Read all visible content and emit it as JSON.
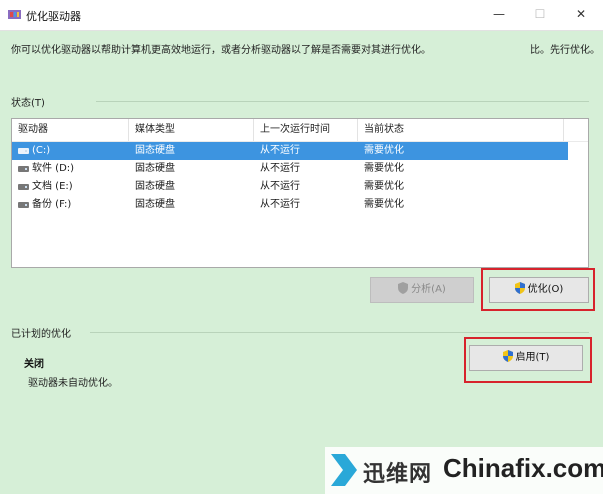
{
  "window": {
    "title": "优化驱动器",
    "controls": {
      "minimize": "—",
      "maximize": "☐",
      "close": "✕"
    }
  },
  "description": "你可以优化驱动器以帮助计算机更高效地运行，或者分析驱动器以了解是否需要对其进行优化。",
  "description_tail": "比。先行优化。",
  "status": {
    "label": "状态(T)",
    "columns": [
      "驱动器",
      "媒体类型",
      "上一次运行时间",
      "当前状态"
    ],
    "rows": [
      {
        "drive": "(C:)",
        "media": "固态硬盘",
        "last_run": "从不运行",
        "status": "需要优化",
        "selected": true
      },
      {
        "drive": "软件 (D:)",
        "media": "固态硬盘",
        "last_run": "从不运行",
        "status": "需要优化",
        "selected": false
      },
      {
        "drive": "文档 (E:)",
        "media": "固态硬盘",
        "last_run": "从不运行",
        "status": "需要优化",
        "selected": false
      },
      {
        "drive": "备份 (F:)",
        "media": "固态硬盘",
        "last_run": "从不运行",
        "status": "需要优化",
        "selected": false
      }
    ]
  },
  "buttons": {
    "analyze": "分析(A)",
    "optimize": "优化(O)",
    "enable": "启用(T)"
  },
  "scheduled": {
    "label": "已计划的优化",
    "state": "关闭",
    "detail": "驱动器未自动优化。"
  },
  "watermark": {
    "cn": "迅维网",
    "en": "Chinafix.com"
  },
  "colors": {
    "background": "#d6efd7",
    "selection": "#3d94e0",
    "highlight_box": "#d7232c"
  }
}
